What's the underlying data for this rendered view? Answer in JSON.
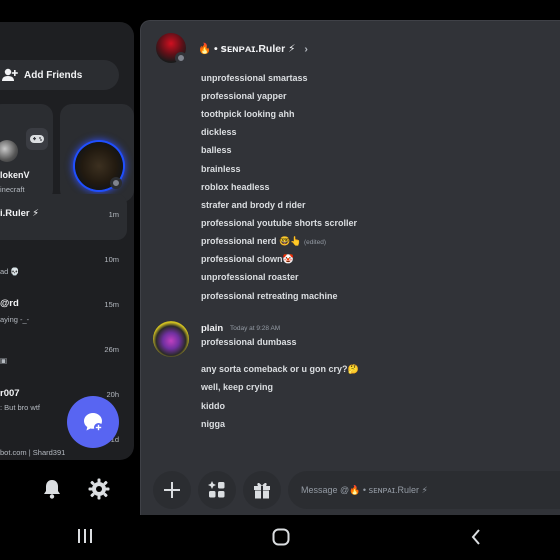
{
  "left": {
    "add_friends_label": "Add Friends",
    "card_a": {
      "name": "lokenV",
      "sub": "inecraft"
    },
    "dms": [
      {
        "name": "i.Ruler ⚡",
        "sub": "",
        "time": "1m"
      },
      {
        "name": "",
        "sub": "ad 💀",
        "time": "10m"
      },
      {
        "name": "@rd",
        "sub": "aying -_-",
        "time": "15m"
      },
      {
        "name": "",
        "sub": "▣",
        "time": "26m"
      },
      {
        "name": "r007",
        "sub": ": But bro wtf",
        "time": "20h"
      },
      {
        "name": "",
        "sub": "bot.com | Shard391",
        "time": "1d"
      }
    ]
  },
  "header": {
    "title": "🔥 • ꜱᴇɴᴘᴀɪ.Ruler ⚡"
  },
  "messages_top": [
    "unprofessional smartass",
    "professional yapper",
    "toothpick looking ahh",
    "dickless",
    "balless",
    "brainless",
    "roblox headless",
    "strafer and brody d rider",
    "professional youtube shorts scroller",
    "professional nerd 🤓👆",
    "professional clown🤡",
    "unprofessional roaster",
    "professional retreating machine"
  ],
  "edited_label": "(edited)",
  "plain": {
    "name": "plain",
    "time": "Today at 9:28 AM",
    "messages": [
      "professional dumbass",
      "any sorta comeback or u gon cry?🤔",
      "well, keep crying",
      "kiddo",
      "nigga"
    ]
  },
  "input": {
    "placeholder": "Message @🔥 • ꜱᴇɴᴘᴀɪ.Ruler ⚡"
  },
  "colors": {
    "accent": "#5865f2",
    "bg_right": "#313338",
    "bg_left": "#1e1f22"
  }
}
